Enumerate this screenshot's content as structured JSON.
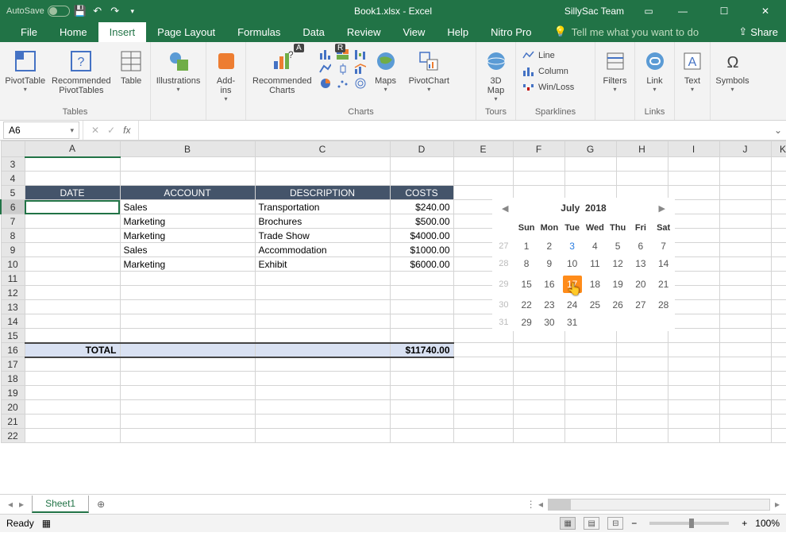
{
  "titlebar": {
    "autosave": "AutoSave",
    "title": "Book1.xlsx - Excel",
    "user": "SillySac Team"
  },
  "tabs": {
    "items": [
      "File",
      "Home",
      "Insert",
      "Page Layout",
      "Formulas",
      "Data",
      "Review",
      "View",
      "Help",
      "Nitro Pro"
    ],
    "active": "Insert",
    "tell_me": "Tell me what you want to do",
    "share": "Share"
  },
  "ribbon": {
    "groups": {
      "tables": {
        "label": "Tables",
        "pivottable": "PivotTable",
        "recommended": "Recommended\nPivotTables",
        "table": "Table"
      },
      "illustrations": {
        "label": "",
        "illustrations": "Illustrations"
      },
      "addins": {
        "label": "",
        "addins": "Add-\nins"
      },
      "charts": {
        "label": "Charts",
        "recommended": "Recommended\nCharts",
        "maps": "Maps",
        "pivotchart": "PivotChart"
      },
      "tours": {
        "label": "Tours",
        "map": "3D\nMap"
      },
      "sparklines": {
        "label": "Sparklines",
        "line": "Line",
        "column": "Column",
        "winloss": "Win/Loss"
      },
      "filters": {
        "label": "",
        "filters": "Filters"
      },
      "links": {
        "label": "Links",
        "link": "Link"
      },
      "text": {
        "label": "",
        "text": "Text"
      },
      "symbols": {
        "label": "",
        "symbols": "Symbols"
      }
    },
    "keytips": {
      "a": "A",
      "r": "R"
    }
  },
  "formula_bar": {
    "name_box": "A6"
  },
  "columns": [
    "",
    "A",
    "B",
    "C",
    "D",
    "E",
    "F",
    "G",
    "H",
    "I",
    "J",
    "K"
  ],
  "rows_visible": [
    3,
    4,
    5,
    6,
    7,
    8,
    9,
    10,
    11,
    12,
    13,
    14,
    15,
    16,
    17,
    18,
    19,
    20,
    21,
    22
  ],
  "table": {
    "header": {
      "date": "DATE",
      "account": "ACCOUNT",
      "description": "DESCRIPTION",
      "costs": "COSTS"
    },
    "rows": [
      {
        "date": "",
        "account": "Sales",
        "description": "Transportation",
        "costs": "$240.00"
      },
      {
        "date": "",
        "account": "Marketing",
        "description": "Brochures",
        "costs": "$500.00"
      },
      {
        "date": "",
        "account": "Marketing",
        "description": "Trade Show",
        "costs": "$4000.00"
      },
      {
        "date": "",
        "account": "Sales",
        "description": "Accommodation",
        "costs": "$1000.00"
      },
      {
        "date": "",
        "account": "Marketing",
        "description": "Exhibit",
        "costs": "$6000.00"
      }
    ],
    "total": {
      "label": "TOTAL",
      "value": "$11740.00"
    }
  },
  "calendar": {
    "title_month": "July",
    "title_year": "2018",
    "dow": [
      "Sun",
      "Mon",
      "Tue",
      "Wed",
      "Thu",
      "Fri",
      "Sat"
    ],
    "weeks": [
      {
        "wk": "27",
        "days": [
          {
            "d": "1"
          },
          {
            "d": "2"
          },
          {
            "d": "3",
            "link": true
          },
          {
            "d": "4"
          },
          {
            "d": "5"
          },
          {
            "d": "6"
          },
          {
            "d": "7"
          }
        ]
      },
      {
        "wk": "28",
        "days": [
          {
            "d": "8"
          },
          {
            "d": "9"
          },
          {
            "d": "10"
          },
          {
            "d": "11"
          },
          {
            "d": "12"
          },
          {
            "d": "13"
          },
          {
            "d": "14"
          }
        ]
      },
      {
        "wk": "29",
        "days": [
          {
            "d": "15"
          },
          {
            "d": "16"
          },
          {
            "d": "17",
            "sel": true
          },
          {
            "d": "18"
          },
          {
            "d": "19"
          },
          {
            "d": "20"
          },
          {
            "d": "21"
          }
        ]
      },
      {
        "wk": "30",
        "days": [
          {
            "d": "22"
          },
          {
            "d": "23"
          },
          {
            "d": "24"
          },
          {
            "d": "25"
          },
          {
            "d": "26"
          },
          {
            "d": "27"
          },
          {
            "d": "28"
          }
        ]
      },
      {
        "wk": "31",
        "days": [
          {
            "d": "29"
          },
          {
            "d": "30"
          },
          {
            "d": "31"
          },
          {
            "d": ""
          },
          {
            "d": ""
          },
          {
            "d": ""
          },
          {
            "d": ""
          }
        ]
      }
    ]
  },
  "sheet_bar": {
    "sheet": "Sheet1"
  },
  "status_bar": {
    "ready": "Ready",
    "zoom": "100%"
  }
}
